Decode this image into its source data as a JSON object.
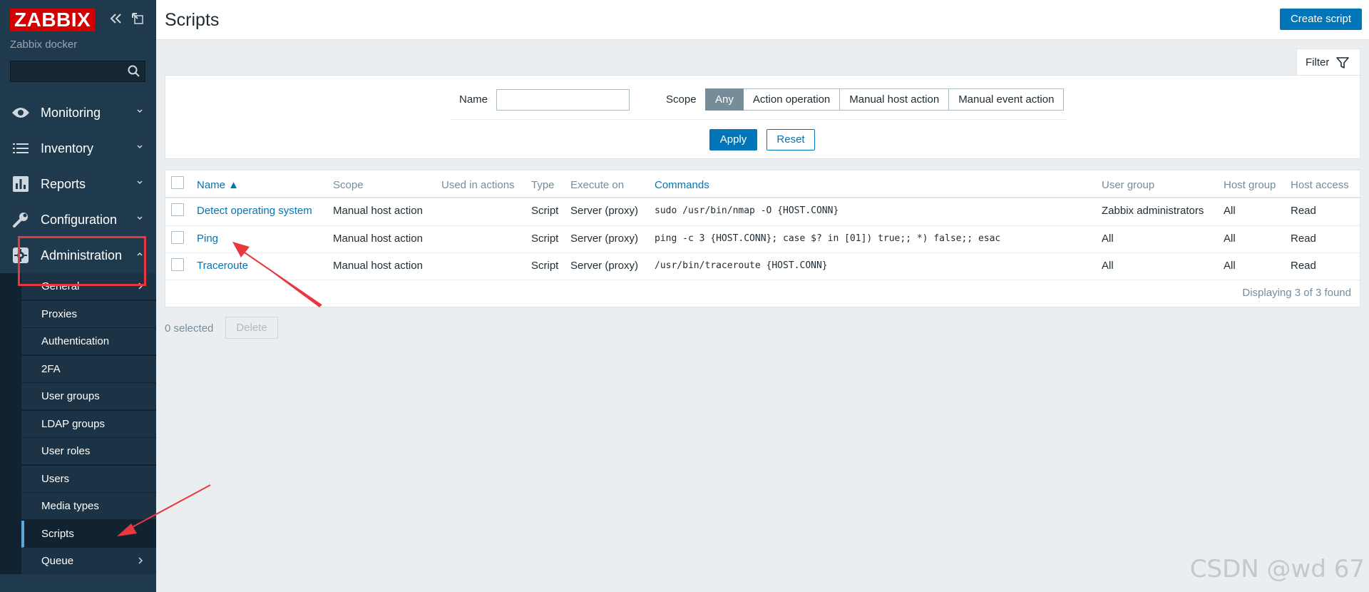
{
  "sidebar": {
    "logo": "ZABBIX",
    "server_name": "Zabbix docker",
    "search_placeholder": "",
    "menu": [
      {
        "label": "Monitoring",
        "icon": "eye-icon"
      },
      {
        "label": "Inventory",
        "icon": "list-icon"
      },
      {
        "label": "Reports",
        "icon": "bar-chart-icon"
      },
      {
        "label": "Configuration",
        "icon": "wrench-icon"
      },
      {
        "label": "Administration",
        "icon": "gear-icon"
      }
    ],
    "submenu": [
      {
        "label": "General"
      },
      {
        "label": "Proxies"
      },
      {
        "label": "Authentication"
      },
      {
        "label": "2FA"
      },
      {
        "label": "User groups"
      },
      {
        "label": "LDAP groups"
      },
      {
        "label": "User roles"
      },
      {
        "label": "Users"
      },
      {
        "label": "Media types"
      },
      {
        "label": "Scripts"
      },
      {
        "label": "Queue"
      }
    ]
  },
  "header": {
    "title": "Scripts",
    "create_button": "Create script"
  },
  "filter": {
    "tab_label": "Filter",
    "name_label": "Name",
    "name_value": "",
    "scope_label": "Scope",
    "scope_options": [
      "Any",
      "Action operation",
      "Manual host action",
      "Manual event action"
    ],
    "scope_selected": "Any",
    "apply": "Apply",
    "reset": "Reset"
  },
  "table": {
    "columns": [
      "Name ▲",
      "Scope",
      "Used in actions",
      "Type",
      "Execute on",
      "Commands",
      "User group",
      "Host group",
      "Host access"
    ],
    "rows": [
      {
        "name": "Detect operating system",
        "scope": "Manual host action",
        "used": "",
        "type": "Script",
        "execute_on": "Server (proxy)",
        "command": "sudo /usr/bin/nmap -O {HOST.CONN}",
        "user_group": "Zabbix administrators",
        "host_group": "All",
        "host_access": "Read"
      },
      {
        "name": "Ping",
        "scope": "Manual host action",
        "used": "",
        "type": "Script",
        "execute_on": "Server (proxy)",
        "command": "ping -c 3 {HOST.CONN}; case $? in [01]) true;; *) false;; esac",
        "user_group": "All",
        "host_group": "All",
        "host_access": "Read"
      },
      {
        "name": "Traceroute",
        "scope": "Manual host action",
        "used": "",
        "type": "Script",
        "execute_on": "Server (proxy)",
        "command": "/usr/bin/traceroute {HOST.CONN}",
        "user_group": "All",
        "host_group": "All",
        "host_access": "Read"
      }
    ],
    "footer": "Displaying 3 of 3 found"
  },
  "actions": {
    "selected": "0 selected",
    "delete": "Delete"
  },
  "watermark": "CSDN @wd 67",
  "colors": {
    "accent": "#0275b8",
    "sidebar": "#1f3a4c",
    "logo": "#d40000",
    "annotation": "#e8383d"
  }
}
